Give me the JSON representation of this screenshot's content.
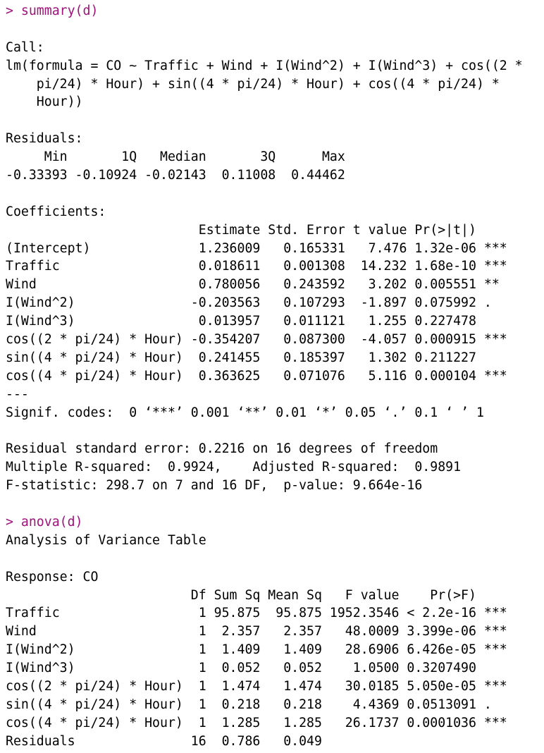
{
  "colors": {
    "command": "#a0127a",
    "output": "#000000",
    "background": "#ffffff"
  },
  "lines": [
    {
      "type": "command",
      "text": "> summary(d)"
    },
    {
      "type": "output",
      "text": ""
    },
    {
      "type": "output",
      "text": "Call:"
    },
    {
      "type": "output",
      "text": "lm(formula = CO ~ Traffic + Wind + I(Wind^2) + I(Wind^3) + cos((2 *"
    },
    {
      "type": "output",
      "text": "    pi/24) * Hour) + sin((4 * pi/24) * Hour) + cos((4 * pi/24) *"
    },
    {
      "type": "output",
      "text": "    Hour))"
    },
    {
      "type": "output",
      "text": ""
    },
    {
      "type": "output",
      "text": "Residuals:"
    },
    {
      "type": "output",
      "text": "     Min       1Q   Median       3Q      Max "
    },
    {
      "type": "output",
      "text": "-0.33393 -0.10924 -0.02143  0.11008  0.44462 "
    },
    {
      "type": "output",
      "text": ""
    },
    {
      "type": "output",
      "text": "Coefficients:"
    },
    {
      "type": "output",
      "text": "                         Estimate Std. Error t value Pr(>|t|)    "
    },
    {
      "type": "output",
      "text": "(Intercept)              1.236009   0.165331   7.476 1.32e-06 ***"
    },
    {
      "type": "output",
      "text": "Traffic                  0.018611   0.001308  14.232 1.68e-10 ***"
    },
    {
      "type": "output",
      "text": "Wind                     0.780056   0.243592   3.202 0.005551 ** "
    },
    {
      "type": "output",
      "text": "I(Wind^2)               -0.203563   0.107293  -1.897 0.075992 .  "
    },
    {
      "type": "output",
      "text": "I(Wind^3)                0.013957   0.011121   1.255 0.227478    "
    },
    {
      "type": "output",
      "text": "cos((2 * pi/24) * Hour) -0.354207   0.087300  -4.057 0.000915 ***"
    },
    {
      "type": "output",
      "text": "sin((4 * pi/24) * Hour)  0.241455   0.185397   1.302 0.211227    "
    },
    {
      "type": "output",
      "text": "cos((4 * pi/24) * Hour)  0.363625   0.071076   5.116 0.000104 ***"
    },
    {
      "type": "output",
      "text": "---"
    },
    {
      "type": "output",
      "text": "Signif. codes:  0 ‘***’ 0.001 ‘**’ 0.01 ‘*’ 0.05 ‘.’ 0.1 ‘ ’ 1"
    },
    {
      "type": "output",
      "text": ""
    },
    {
      "type": "output",
      "text": "Residual standard error: 0.2216 on 16 degrees of freedom"
    },
    {
      "type": "output",
      "text": "Multiple R-squared:  0.9924,    Adjusted R-squared:  0.9891 "
    },
    {
      "type": "output",
      "text": "F-statistic: 298.7 on 7 and 16 DF,  p-value: 9.664e-16"
    },
    {
      "type": "output",
      "text": ""
    },
    {
      "type": "command",
      "text": "> anova(d)"
    },
    {
      "type": "output",
      "text": "Analysis of Variance Table"
    },
    {
      "type": "output",
      "text": ""
    },
    {
      "type": "output",
      "text": "Response: CO"
    },
    {
      "type": "output",
      "text": "                        Df Sum Sq Mean Sq   F value    Pr(>F)    "
    },
    {
      "type": "output",
      "text": "Traffic                  1 95.875  95.875 1952.3546 < 2.2e-16 ***"
    },
    {
      "type": "output",
      "text": "Wind                     1  2.357   2.357   48.0009 3.399e-06 ***"
    },
    {
      "type": "output",
      "text": "I(Wind^2)                1  1.409   1.409   28.6906 6.426e-05 ***"
    },
    {
      "type": "output",
      "text": "I(Wind^3)                1  0.052   0.052    1.0500 0.3207490    "
    },
    {
      "type": "output",
      "text": "cos((2 * pi/24) * Hour)  1  1.474   1.474   30.0185 5.050e-05 ***"
    },
    {
      "type": "output",
      "text": "sin((4 * pi/24) * Hour)  1  0.218   0.218    4.4369 0.0513091 .  "
    },
    {
      "type": "output",
      "text": "cos((4 * pi/24) * Hour)  1  1.285   1.285   26.1737 0.0001036 ***"
    },
    {
      "type": "output",
      "text": "Residuals               16  0.786   0.049                       "
    }
  ]
}
